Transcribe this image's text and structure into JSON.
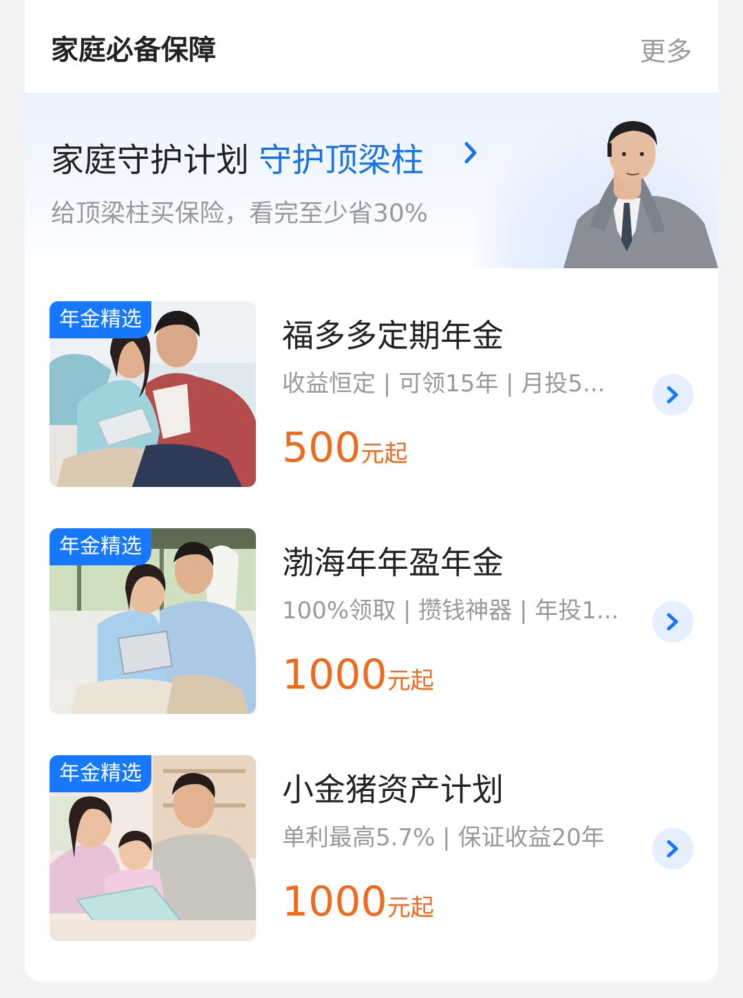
{
  "section": {
    "title": "家庭必备保障",
    "more_label": "更多"
  },
  "banner": {
    "title": "家庭守护计划",
    "highlight": "守护顶梁柱",
    "subtitle": "给顶梁柱买保险，看完至少省30%"
  },
  "products": [
    {
      "tag": "年金精选",
      "title": "福多多定期年金",
      "desc": "收益恒定 | 可领15年 | 月投5...",
      "price": "500",
      "price_unit": "元起"
    },
    {
      "tag": "年金精选",
      "title": "渤海年年盈年金",
      "desc": "100%领取 | 攒钱神器 | 年投1...",
      "price": "1000",
      "price_unit": "元起"
    },
    {
      "tag": "年金精选",
      "title": "小金猪资产计划",
      "desc": "单利最高5.7% | 保证收益20年",
      "price": "1000",
      "price_unit": "元起"
    }
  ],
  "colors": {
    "accent": "#1677ff",
    "highlight_text": "#1a73e8",
    "price": "#f06a1e",
    "muted_text": "#999999"
  }
}
